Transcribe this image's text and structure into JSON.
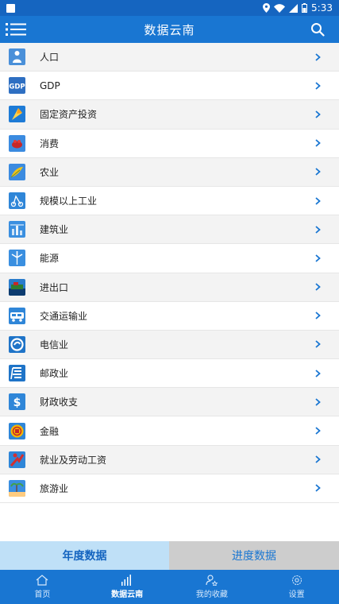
{
  "status_bar": {
    "time": "5:33"
  },
  "app_bar": {
    "title": "数据云南"
  },
  "categories": [
    {
      "label": "人口",
      "icon": "population-icon",
      "color": "#4a90d9"
    },
    {
      "label": "GDP",
      "icon": "gdp-icon",
      "color": "#2e6fc2"
    },
    {
      "label": "固定资产投资",
      "icon": "fixed-asset-icon",
      "color": "#1e7bd6"
    },
    {
      "label": "消费",
      "icon": "consumption-icon",
      "color": "#3b8be0"
    },
    {
      "label": "农业",
      "icon": "agriculture-icon",
      "color": "#3b8be0"
    },
    {
      "label": "规模以上工业",
      "icon": "industry-icon",
      "color": "#2f86d8"
    },
    {
      "label": "建筑业",
      "icon": "construction-icon",
      "color": "#3a8fe0"
    },
    {
      "label": "能源",
      "icon": "energy-icon",
      "color": "#3a8fe0"
    },
    {
      "label": "进出口",
      "icon": "import-export-icon",
      "color": "#2a7ccc"
    },
    {
      "label": "交通运输业",
      "icon": "transport-icon",
      "color": "#2f86d8"
    },
    {
      "label": "电信业",
      "icon": "telecom-icon",
      "color": "#1f74c8"
    },
    {
      "label": "邮政业",
      "icon": "postal-icon",
      "color": "#1f74c8"
    },
    {
      "label": "财政收支",
      "icon": "finance-icon",
      "color": "#2f86d8"
    },
    {
      "label": "金融",
      "icon": "banking-icon",
      "color": "#2f86d8"
    },
    {
      "label": "就业及劳动工资",
      "icon": "employment-icon",
      "color": "#2f86d8"
    },
    {
      "label": "旅游业",
      "icon": "tourism-icon",
      "color": "#3a8fe0"
    }
  ],
  "segments": {
    "annual": "年度数据",
    "progress": "进度数据",
    "active": "annual"
  },
  "bottom_nav": [
    {
      "label": "首页",
      "icon": "home-icon",
      "active": false
    },
    {
      "label": "数据云南",
      "icon": "bar-chart-icon",
      "active": true
    },
    {
      "label": "我的收藏",
      "icon": "favorites-icon",
      "active": false
    },
    {
      "label": "设置",
      "icon": "settings-icon",
      "active": false
    }
  ],
  "colors": {
    "primary": "#1976d2",
    "status": "#1565c0",
    "chevron": "#1976d2",
    "segment_active": "#bfe0f7",
    "segment_inactive": "#cdcdcd"
  }
}
